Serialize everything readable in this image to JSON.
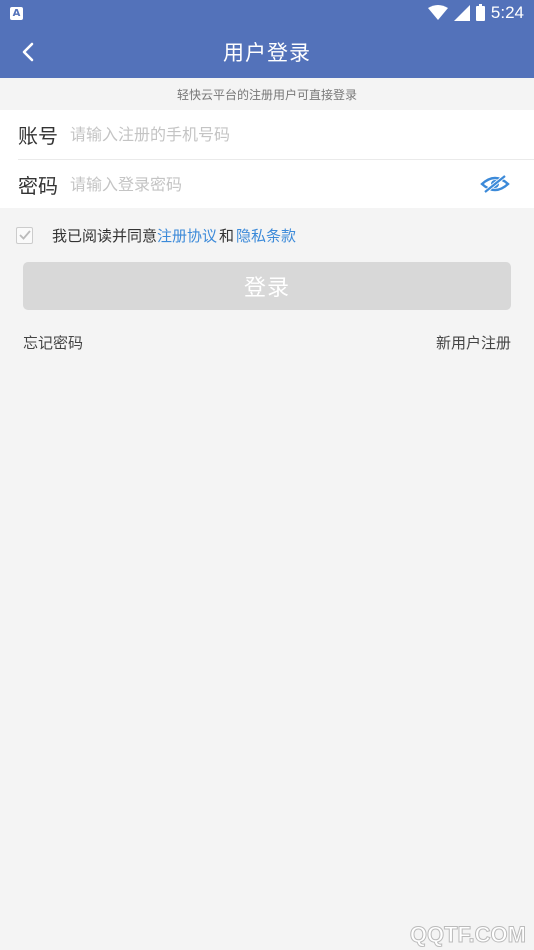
{
  "status_bar": {
    "time": "5:24",
    "notification_letter": "A",
    "icons": [
      "notification-icon",
      "wifi-icon",
      "signal-icon",
      "battery-icon"
    ]
  },
  "app_bar": {
    "title": "用户登录",
    "back_icon": "back-arrow-icon"
  },
  "subtitle": "轻快云平台的注册用户可直接登录",
  "form": {
    "account": {
      "label": "账号",
      "value": "",
      "placeholder": "请输入注册的手机号码"
    },
    "password": {
      "label": "密码",
      "value": "",
      "placeholder": "请输入登录密码",
      "visibility_icon": "eye-off-icon"
    }
  },
  "agreement": {
    "prefix": "我已阅读并同意",
    "terms_link": "注册协议",
    "conjunction": "和",
    "privacy_link": "隐私条款",
    "checked": true
  },
  "login_button": "登录",
  "links": {
    "forgot_password": "忘记密码",
    "register": "新用户注册"
  },
  "watermark": "QQTF.COM",
  "colors": {
    "primary": "#5372ba",
    "link": "#3c8ad9",
    "button_disabled": "#d8d8d8",
    "background": "#f4f4f4"
  }
}
